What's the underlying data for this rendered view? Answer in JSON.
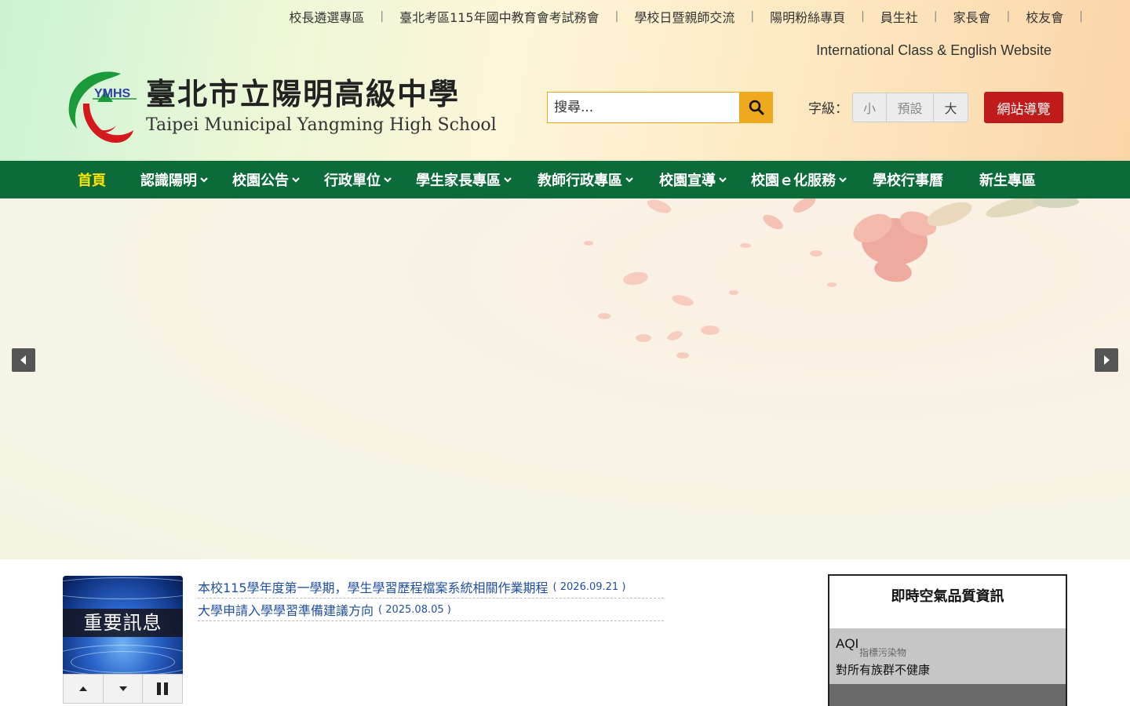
{
  "top_links": [
    "校長遴選專區",
    "臺北考區115年國中教育會考試務會",
    "學校日暨親師交流",
    "陽明粉絲專頁",
    "員生社",
    "家長會",
    "校友會"
  ],
  "separator": "|",
  "english_link": "International Class & English Website",
  "logo": {
    "text": "YMHS"
  },
  "school": {
    "name_zh": "臺北市立陽明高級中學",
    "name_en": "Taipei Municipal Yangming High School"
  },
  "search": {
    "placeholder": "搜尋..."
  },
  "font_size": {
    "label": "字級：",
    "small": "小",
    "default": "預設",
    "large": "大"
  },
  "sitemap_label": "網站導覽",
  "nav": {
    "home": "首頁",
    "about": "認識陽明",
    "announcements": "校園公告",
    "admin_units": "行政單位",
    "students_parents": "學生家長專區",
    "teachers": "教師行政專區",
    "publicity": "校園宣導",
    "e_services": "校園ｅ化服務",
    "calendar": "學校行事曆",
    "freshman": "新生專區"
  },
  "news": {
    "image_title": "重要訊息",
    "items": [
      {
        "title": "本校115學年度第一學期，學生學習歷程檔案系統相關作業期程",
        "date": "( 2026.09.21 )"
      },
      {
        "title": "大學申請入學學習準備建議方向",
        "date": "( 2025.08.05 )"
      }
    ]
  },
  "aqi": {
    "title": "即時空氣品質資訊",
    "label": "AQI",
    "sub_label": "指標污染物",
    "status": "對所有族群不健康"
  },
  "colors": {
    "nav_bg": "#0c6b3b",
    "nav_active": "#ffe600",
    "search_btn": "#f0a81e",
    "sitemap_btn": "#c01b1b",
    "news_text": "#1f4f9f"
  }
}
